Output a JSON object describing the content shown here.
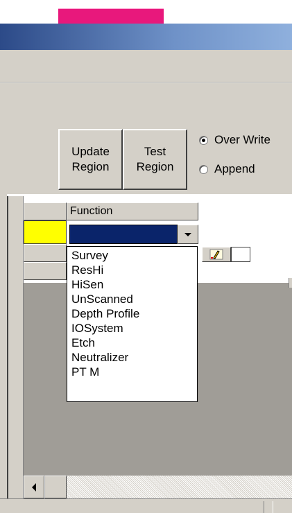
{
  "toolbar": {
    "update_region": [
      "Update",
      "Region"
    ],
    "test_region": [
      "Test",
      "Region"
    ]
  },
  "write_mode": {
    "options": [
      "Over Write",
      "Append"
    ],
    "selected": "Over Write"
  },
  "grid": {
    "column_header": "Function",
    "selected_row_color": "#ffff00"
  },
  "function_dropdown": {
    "current_value": "",
    "options": [
      "Survey",
      "ResHi",
      "HiSen",
      "UnScanned",
      "Depth Profile",
      "IOSystem",
      "Etch",
      "Neutralizer",
      "PT M"
    ]
  },
  "colors": {
    "title_bar_start": "#2c4a88",
    "title_bar_end": "#8fb0dd",
    "tab_accent": "#e8187c",
    "selection": "#0a246a",
    "window_face": "#d4d0c8"
  },
  "icons": {
    "edit": "pencil-icon",
    "dropdown": "chevron-down-icon",
    "scroll_left": "arrow-left-icon"
  }
}
